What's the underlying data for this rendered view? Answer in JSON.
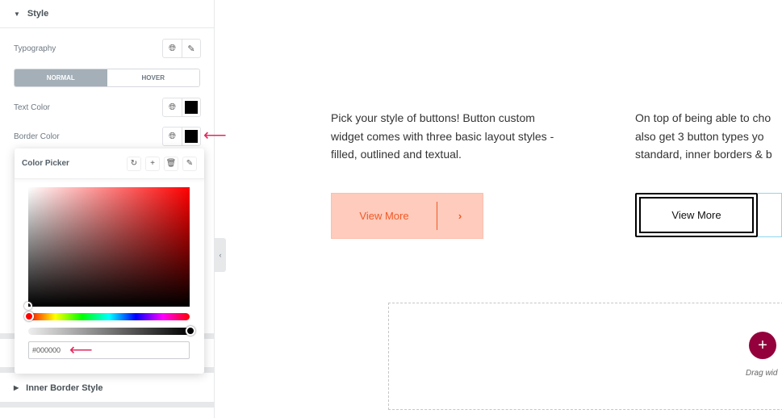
{
  "panel": {
    "style_section": "Style",
    "typography_label": "Typography",
    "tabs": [
      "NORMAL",
      "HOVER"
    ],
    "text_color_label": "Text Color",
    "border_color_label": "Border Color",
    "inner_border_section": "Inner Border Style"
  },
  "color_picker": {
    "title": "Color Picker",
    "hex_value": "#000000",
    "hue": 0,
    "alpha": 1,
    "icons": [
      "reset-icon",
      "plus-icon",
      "trash-icon",
      "eyedropper-icon"
    ]
  },
  "canvas": {
    "para1": [
      "Pick your style of buttons! Button custom",
      "widget comes with three basic layout styles -",
      "filled, outlined and textual."
    ],
    "para2": [
      "On top of being able to cho",
      "also get 3 button types yo",
      "standard, inner borders & b"
    ],
    "button1_label": "View More",
    "button2_label": "View More",
    "drag_text": "Drag wid"
  },
  "colors": {
    "accent": "#e2285d",
    "add_button": "#93003c",
    "button1_bg": "#fecbbc",
    "button1_text": "#f05a28"
  }
}
